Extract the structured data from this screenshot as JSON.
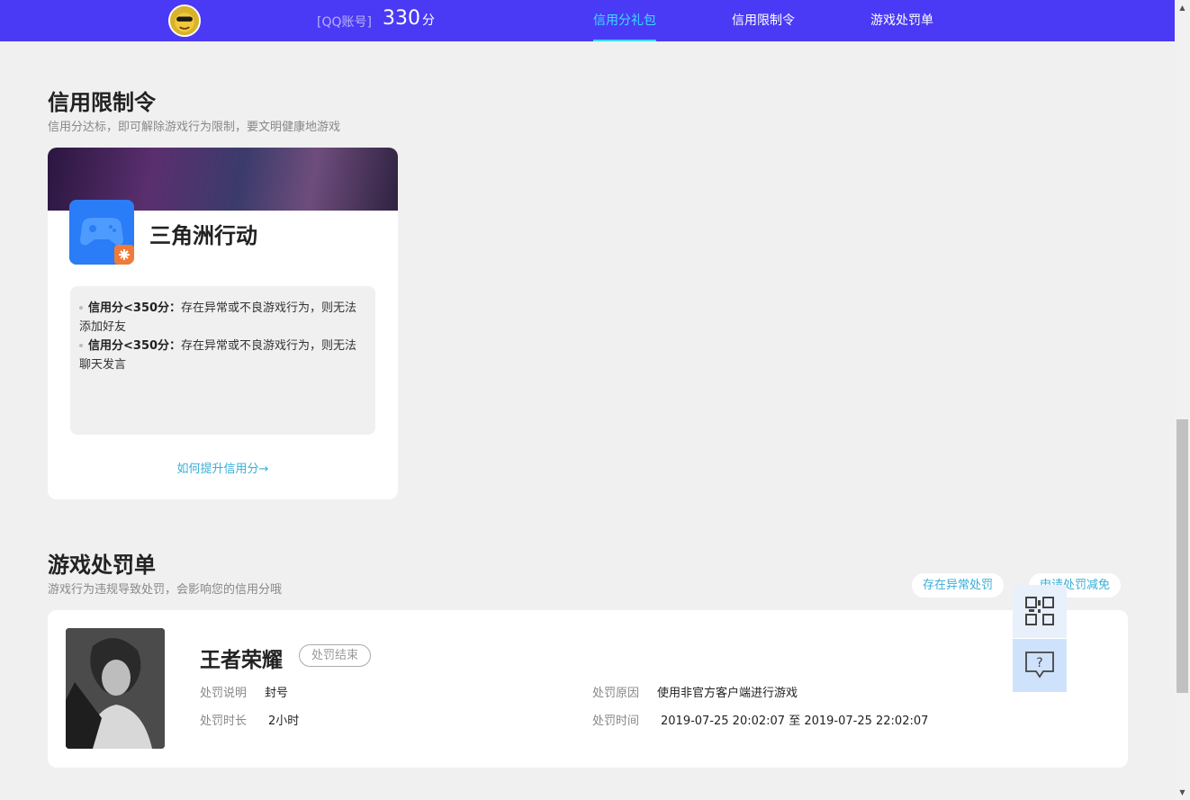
{
  "header": {
    "account_label": "[QQ账号]",
    "score": "330",
    "score_unit": "分",
    "nav": [
      "信用分礼包",
      "信用限制令",
      "游戏处罚单"
    ],
    "active_nav": "信用分礼包",
    "accent_color": "#4a3af5"
  },
  "limit_section": {
    "title": "信用限制令",
    "subtitle": "信用分达标，即可解除游戏行为限制，要文明健康地游戏",
    "card": {
      "game_name": "三角洲行动",
      "rules": [
        {
          "key": "信用分<350分：",
          "text": "存在异常或不良游戏行为，则无法添加好友"
        },
        {
          "key": "信用分<350分：",
          "text": "存在异常或不良游戏行为，则无法聊天发言"
        }
      ],
      "link_text": "如何提升信用分→"
    }
  },
  "penalty_section": {
    "title": "游戏处罚单",
    "subtitle": "游戏行为违规导致处罚，会影响您的信用分哦",
    "buttons": [
      "存在异常处罚",
      "申请处罚减免"
    ],
    "card": {
      "game_name": "王者荣耀",
      "status": "处罚结束",
      "fields": {
        "desc_label": "处罚说明",
        "desc_value": "封号",
        "duration_label": "处罚时长",
        "duration_value": "2小时",
        "reason_label": "处罚原因",
        "reason_value": "使用非官方客户端进行游戏",
        "time_label": "处罚时间",
        "time_value": "2019-07-25 20:02:07 至 2019-07-25 22:02:07"
      }
    }
  },
  "icons": {
    "qr": "qr-code-icon",
    "help": "help-chat-icon"
  }
}
